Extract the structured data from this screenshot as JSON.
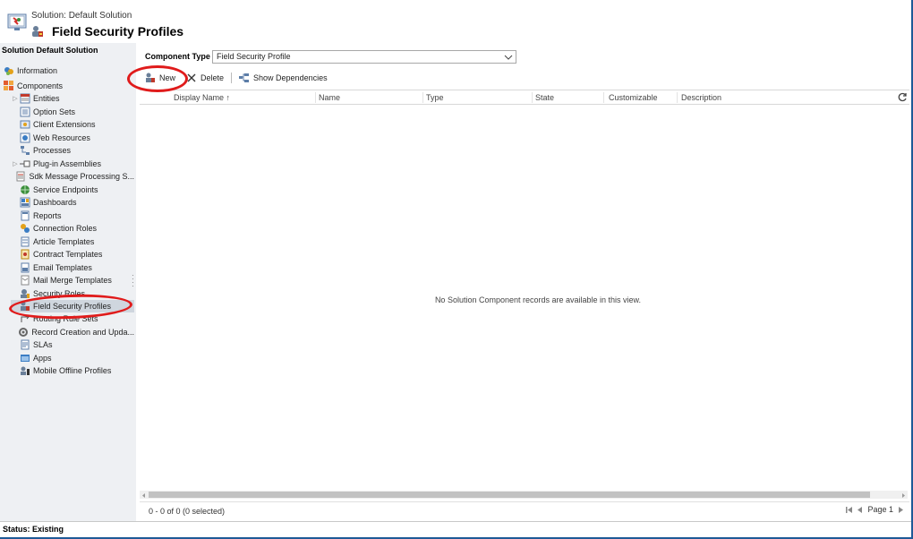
{
  "header": {
    "solution_label": "Solution: Default Solution",
    "page_title": "Field Security Profiles"
  },
  "sidebar": {
    "heading": "Solution Default Solution",
    "roots": [
      {
        "label": "Information",
        "icon": "information-icon"
      },
      {
        "label": "Components",
        "icon": "components-icon"
      }
    ],
    "items": [
      {
        "label": "Entities",
        "icon": "entities-icon",
        "expandable": true
      },
      {
        "label": "Option Sets",
        "icon": "option-sets-icon"
      },
      {
        "label": "Client Extensions",
        "icon": "client-extensions-icon"
      },
      {
        "label": "Web Resources",
        "icon": "web-resources-icon"
      },
      {
        "label": "Processes",
        "icon": "processes-icon"
      },
      {
        "label": "Plug-in Assemblies",
        "icon": "plugin-assemblies-icon",
        "expandable": true
      },
      {
        "label": "Sdk Message Processing S...",
        "icon": "sdk-message-icon"
      },
      {
        "label": "Service Endpoints",
        "icon": "service-endpoints-icon"
      },
      {
        "label": "Dashboards",
        "icon": "dashboards-icon"
      },
      {
        "label": "Reports",
        "icon": "reports-icon"
      },
      {
        "label": "Connection Roles",
        "icon": "connection-roles-icon"
      },
      {
        "label": "Article Templates",
        "icon": "article-templates-icon"
      },
      {
        "label": "Contract Templates",
        "icon": "contract-templates-icon"
      },
      {
        "label": "Email Templates",
        "icon": "email-templates-icon"
      },
      {
        "label": "Mail Merge Templates",
        "icon": "mail-merge-templates-icon"
      },
      {
        "label": "Security Roles",
        "icon": "security-roles-icon"
      },
      {
        "label": "Field Security Profiles",
        "icon": "field-security-profiles-icon",
        "selected": true
      },
      {
        "label": "Routing Rule Sets",
        "icon": "routing-rule-sets-icon"
      },
      {
        "label": "Record Creation and Upda...",
        "icon": "record-creation-icon"
      },
      {
        "label": "SLAs",
        "icon": "slas-icon"
      },
      {
        "label": "Apps",
        "icon": "apps-icon"
      },
      {
        "label": "Mobile Offline Profiles",
        "icon": "mobile-offline-profiles-icon"
      }
    ]
  },
  "main": {
    "component_type_label": "Component Type",
    "component_type_value": "Field Security Profile",
    "toolbar": {
      "new_label": "New",
      "delete_label": "Delete",
      "show_dependencies_label": "Show Dependencies"
    },
    "columns": [
      "Display Name",
      "Name",
      "Type",
      "State",
      "Customizable",
      "Description"
    ],
    "sort_indicator": "↑",
    "empty_message": "No Solution Component records are available in this view.",
    "record_count": "0 - 0 of 0 (0 selected)",
    "page_label": "Page 1"
  },
  "status": {
    "text": "Status: Existing"
  },
  "colors": {
    "annotation": "#e01b1b",
    "sidebar_bg": "#eef0f3",
    "selected_bg": "#cfd6de",
    "frame_border": "#1e5a96"
  }
}
